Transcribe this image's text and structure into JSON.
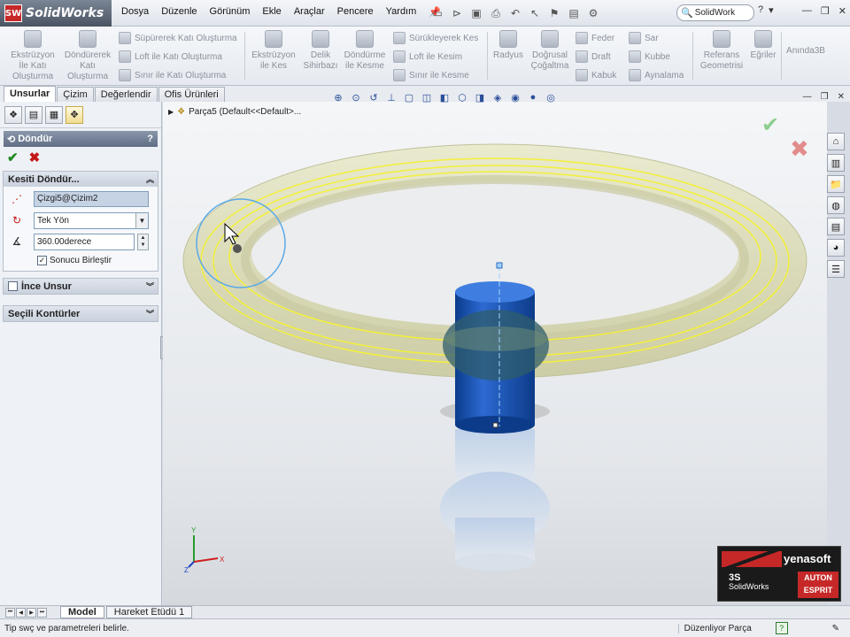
{
  "app": {
    "logo_badge": "SW",
    "logo_text": "SolidWorks"
  },
  "menu": [
    "Dosya",
    "Düzenle",
    "Görünüm",
    "Ekle",
    "Araçlar",
    "Pencere",
    "Yardım"
  ],
  "search": {
    "value": "SolidWork"
  },
  "ribbon": {
    "extrude_boss": "Ekstrüzyon İle Katı Oluşturma",
    "revolve_boss": "Döndürerek Katı Oluşturma",
    "swept_boss": "Süpürerek Katı Oluşturma",
    "loft_boss": "Loft ile Katı Oluşturma",
    "boundary_boss": "Sınır ile Katı Oluşturma",
    "extrude_cut": "Ekstrüzyon ile Kes",
    "hole_wizard": "Delik Sihirbazı",
    "revolve_cut": "Döndürme ile Kesme",
    "swept_cut": "Sürükleyerek Kes",
    "loft_cut": "Loft ile Kesim",
    "boundary_cut": "Sınır ile Kesme",
    "fillet": "Radyus",
    "linear_pattern": "Doğrusal Çoğaltma",
    "rib": "Feder",
    "draft": "Draft",
    "shell": "Kabuk",
    "wrap": "Sar",
    "dome": "Kubbe",
    "mirror": "Aynalama",
    "ref_geometry": "Referans Geometrisi",
    "curves": "Eğriler",
    "instant3d": "Anında3B"
  },
  "tabs": [
    "Unsurlar",
    "Çizim",
    "Değerlendir",
    "Ofis Ürünleri"
  ],
  "panel": {
    "title": "Döndür",
    "help": "?",
    "group_axis": {
      "title": "Kesiti Döndür...",
      "axis_value": "Çizgi5@Çizim2",
      "direction": "Tek Yön",
      "angle": "360.00derece",
      "merge_label": "Sonucu Birleştir",
      "merge_checked": true
    },
    "group_thin": {
      "title": "İnce Unsur"
    },
    "group_contours": {
      "title": "Seçili Kontürler"
    }
  },
  "viewport": {
    "tree_label": "Parça5  (Default<<Default>..."
  },
  "triad": {
    "x": "X",
    "y": "Y",
    "z": "Z"
  },
  "brand": {
    "yenasoft": "yenasoft",
    "ds": "3S",
    "solidworks": "SolidWorks",
    "auton": "AUTON",
    "esprit": "ESPRIT"
  },
  "bottom_tabs": [
    "Model",
    "Hareket Etüdü 1"
  ],
  "status": {
    "message": "Tip swç ve parametreleri belirle.",
    "mode": "Düzenliyor Parça"
  }
}
